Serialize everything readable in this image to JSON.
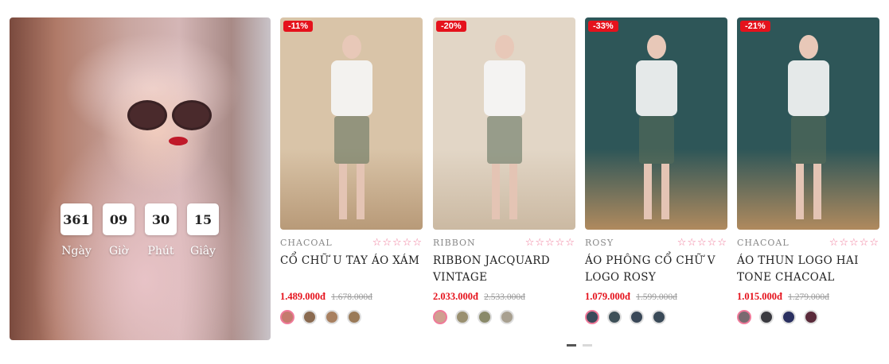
{
  "promo": {
    "countdown": [
      {
        "value": "361",
        "label": "Ngày"
      },
      {
        "value": "09",
        "label": "Giờ"
      },
      {
        "value": "30",
        "label": "Phút"
      },
      {
        "value": "15",
        "label": "Giây"
      }
    ]
  },
  "products": [
    {
      "discount": "-11%",
      "brand": "CHACOAL",
      "stars": "☆☆☆☆☆",
      "name": "CỔ CHỮ U TAY ÁO XÁM",
      "price": "1.489.000đ",
      "old_price": "1.678.000đ",
      "swatches": [
        "#c57a6e",
        "#8a6a50",
        "#a88060",
        "#9a7a58"
      ],
      "bg": "#d9c4a8",
      "floor": "#b89a78"
    },
    {
      "discount": "-20%",
      "brand": "RIBBON",
      "stars": "☆☆☆☆☆",
      "name": "RIBBON JACQUARD VINTAGE",
      "price": "2.033.000đ",
      "old_price": "2.533.000đ",
      "swatches": [
        "#cfa090",
        "#9a9070",
        "#8a8a6a",
        "#a8a090"
      ],
      "bg": "#e2d6c6",
      "floor": "#cbb9a2"
    },
    {
      "discount": "-33%",
      "brand": "ROSY",
      "stars": "☆☆☆☆☆",
      "name": "ÁO PHÔNG CỔ CHỮ V LOGO ROSY",
      "price": "1.079.000đ",
      "old_price": "1.599.000đ",
      "swatches": [
        "#3a4a5a",
        "#3e5058",
        "#3a4858",
        "#3a4a58"
      ],
      "bg": "#2e5658",
      "floor": "#b08a5e"
    },
    {
      "discount": "-21%",
      "brand": "CHACOAL",
      "stars": "☆☆☆☆☆",
      "name": "ÁO THUN LOGO HAI TONE CHACOAL",
      "price": "1.015.000đ",
      "old_price": "1.279.000đ",
      "swatches": [
        "#7a6a70",
        "#3a3a40",
        "#2a3060",
        "#5a2a3a"
      ],
      "bg": "#2e5658",
      "floor": "#b08a5e"
    }
  ]
}
